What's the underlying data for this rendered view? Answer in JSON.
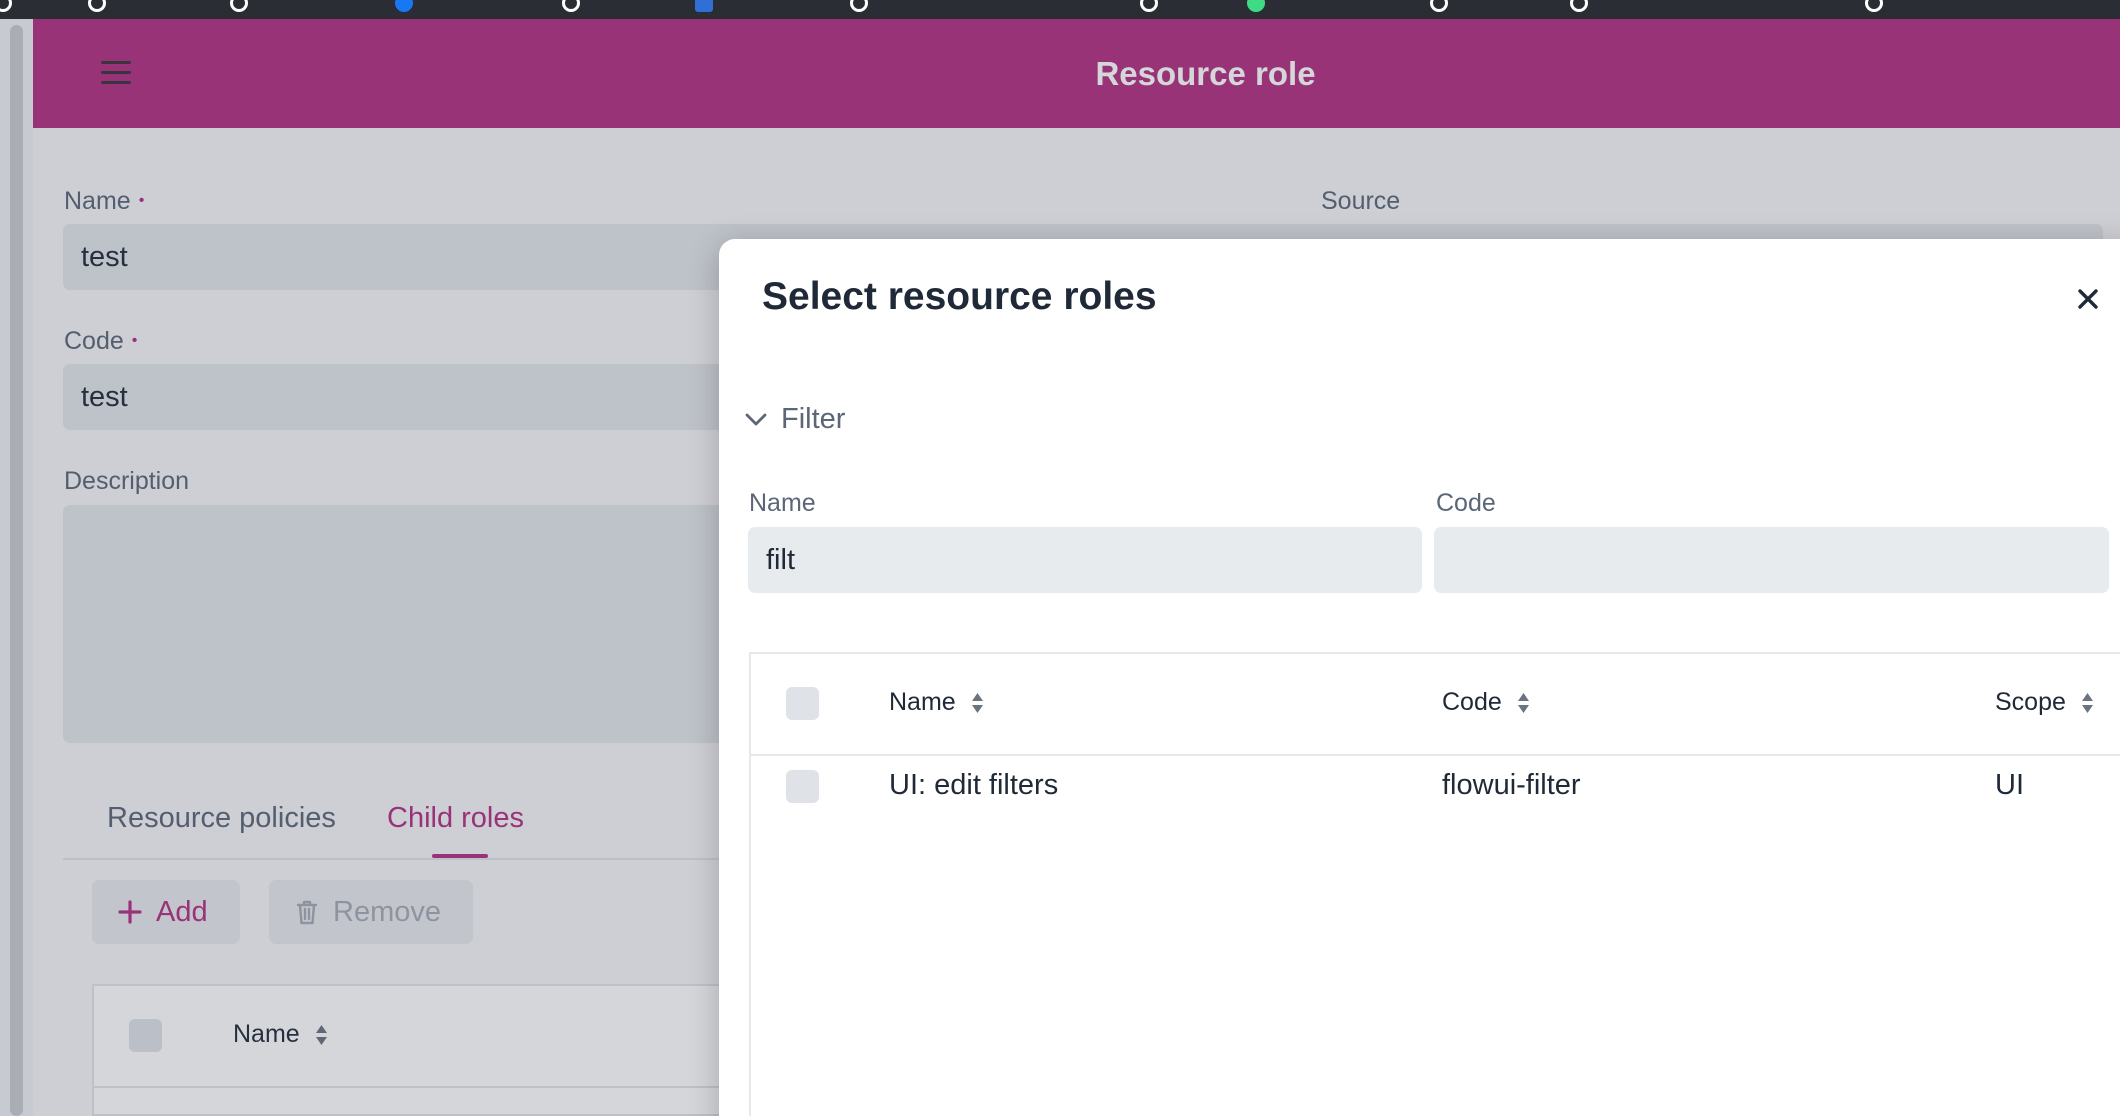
{
  "header": {
    "title": "Resource role"
  },
  "form": {
    "name_label": "Name",
    "name_value": "test",
    "code_label": "Code",
    "code_value": "test",
    "description_label": "Description",
    "description_value": "",
    "source_label": "Source",
    "required_marker": "•"
  },
  "tabs": [
    {
      "label": "Resource policies",
      "active": false
    },
    {
      "label": "Child roles",
      "active": true
    }
  ],
  "actions": {
    "add_label": "Add",
    "remove_label": "Remove"
  },
  "child_grid": {
    "columns": [
      "Name"
    ]
  },
  "dialog": {
    "title": "Select resource roles",
    "filter_label": "Filter",
    "filter_fields": {
      "name_label": "Name",
      "name_value": "filt",
      "code_label": "Code",
      "code_value": ""
    },
    "grid": {
      "columns": [
        "Name",
        "Code",
        "Scope"
      ],
      "rows": [
        {
          "name": "UI: edit filters",
          "code": "flowui-filter",
          "scope": "UI"
        }
      ]
    }
  },
  "colors": {
    "brand": "#b42f80",
    "header_text": "#ffffff",
    "field_bg": "#e3e6ea"
  },
  "icons": [
    "menu-icon",
    "plus-icon",
    "trash-icon",
    "sort-icon",
    "chevron-down-icon",
    "close-icon"
  ]
}
